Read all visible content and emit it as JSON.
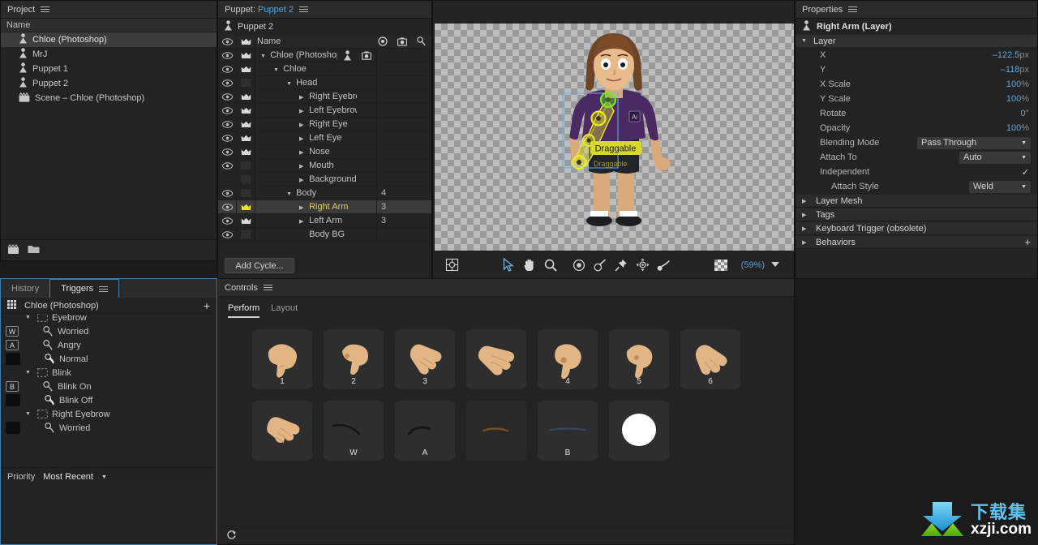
{
  "project": {
    "title": "Project",
    "menu_icon": "hamburger-icon",
    "column_header": "Name",
    "items": [
      {
        "label": "Chloe (Photoshop)",
        "icon": "puppet-icon",
        "selected": true
      },
      {
        "label": "MrJ",
        "icon": "puppet-icon",
        "selected": false
      },
      {
        "label": "Puppet 1",
        "icon": "puppet-icon",
        "selected": false
      },
      {
        "label": "Puppet 2",
        "icon": "puppet-icon",
        "selected": false
      },
      {
        "label": "Scene – Chloe (Photoshop)",
        "icon": "scene-icon",
        "selected": false
      }
    ],
    "footer_icons": [
      "new-scene-icon",
      "new-folder-icon"
    ]
  },
  "puppet": {
    "title_prefix": "Puppet:",
    "title_name": "Puppet 2",
    "menu_icon": "hamburger-icon",
    "root_label": "Puppet 2",
    "column_header": "Name",
    "header_icons": [
      "crosshair-icon",
      "camera-icon",
      "handle-icon"
    ],
    "rows": [
      {
        "label": "Chloe (Photoshop)",
        "depth": 0,
        "twirl": "down",
        "crown": true,
        "eye": true,
        "num": "",
        "icon1": "puppet-icon",
        "icon2": "camera-icon",
        "selected": false
      },
      {
        "label": "Chloe",
        "depth": 1,
        "twirl": "down",
        "crown": true,
        "eye": true,
        "num": "",
        "selected": false
      },
      {
        "label": "Head",
        "depth": 2,
        "twirl": "down",
        "crown": false,
        "eye": true,
        "num": "",
        "selected": false
      },
      {
        "label": "Right Eyebrow",
        "depth": 3,
        "twirl": "right",
        "crown": true,
        "eye": true,
        "num": "",
        "selected": false
      },
      {
        "label": "Left Eyebrow",
        "depth": 3,
        "twirl": "right",
        "crown": true,
        "eye": true,
        "num": "",
        "selected": false
      },
      {
        "label": "Right Eye",
        "depth": 3,
        "twirl": "right",
        "crown": true,
        "eye": true,
        "num": "",
        "selected": false
      },
      {
        "label": "Left Eye",
        "depth": 3,
        "twirl": "right",
        "crown": true,
        "eye": true,
        "num": "",
        "selected": false
      },
      {
        "label": "Nose",
        "depth": 3,
        "twirl": "right",
        "crown": true,
        "eye": true,
        "num": "",
        "selected": false
      },
      {
        "label": "Mouth",
        "depth": 3,
        "twirl": "right",
        "crown": false,
        "eye": true,
        "num": "",
        "selected": false
      },
      {
        "label": "Background",
        "depth": 3,
        "twirl": "right",
        "crown": false,
        "eye": false,
        "num": "",
        "selected": false
      },
      {
        "label": "Body",
        "depth": 2,
        "twirl": "down",
        "crown": false,
        "eye": true,
        "num": "4",
        "selected": false
      },
      {
        "label": "Right Arm",
        "depth": 3,
        "twirl": "right",
        "crown": true,
        "eye": true,
        "num": "3",
        "selected": true
      },
      {
        "label": "Left Arm",
        "depth": 3,
        "twirl": "right",
        "crown": true,
        "eye": true,
        "num": "3",
        "selected": false
      },
      {
        "label": "Body BG",
        "depth": 3,
        "twirl": "none",
        "crown": false,
        "eye": true,
        "num": "",
        "selected": false
      }
    ],
    "add_cycle_label": "Add Cycle..."
  },
  "canvas": {
    "zoom_label": "(59%)",
    "handle_labels": [
      "Draggable",
      "Draggable"
    ],
    "tools": [
      {
        "name": "origin-icon"
      },
      {
        "name": "arrow-select-icon",
        "active": true
      },
      {
        "name": "hand-pan-icon"
      },
      {
        "name": "magnifier-zoom-icon"
      },
      {
        "name": "handle-tool-icon"
      },
      {
        "name": "dangle-tool-icon"
      },
      {
        "name": "stick-pin-icon"
      },
      {
        "name": "dragger-tool-icon"
      },
      {
        "name": "pitch-tool-icon"
      },
      {
        "name": "transparency-grid-icon"
      },
      {
        "name": "zoom-dropdown-caret-icon"
      }
    ]
  },
  "properties": {
    "title": "Properties",
    "menu_icon": "hamburger-icon",
    "object_name": "Right Arm (Layer)",
    "object_icon": "puppet-icon",
    "layer_section": "Layer",
    "rows": [
      {
        "label": "X",
        "value": "–122.5",
        "unit": "px",
        "type": "number"
      },
      {
        "label": "Y",
        "value": "–118",
        "unit": "px",
        "type": "number"
      },
      {
        "label": "X Scale",
        "value": "100",
        "unit": "%",
        "type": "number"
      },
      {
        "label": "Y Scale",
        "value": "100",
        "unit": "%",
        "type": "number"
      },
      {
        "label": "Rotate",
        "value": "0",
        "unit": "°",
        "type": "number"
      },
      {
        "label": "Opacity",
        "value": "100",
        "unit": "%",
        "type": "number"
      }
    ],
    "blending_mode": {
      "label": "Blending Mode",
      "value": "Pass Through"
    },
    "attach_to": {
      "label": "Attach To",
      "value": "Auto"
    },
    "independent": {
      "label": "Independent",
      "checked": true,
      "check_glyph": "✓"
    },
    "attach_style": {
      "label": "Attach Style",
      "value": "Weld"
    },
    "collapsed_sections": [
      {
        "label": "Layer Mesh",
        "plus": false
      },
      {
        "label": "Tags",
        "plus": false
      },
      {
        "label": "Keyboard Trigger (obsolete)",
        "plus": false
      },
      {
        "label": "Behaviors",
        "plus": true,
        "plus_glyph": "+"
      }
    ]
  },
  "triggers": {
    "tabs": [
      {
        "label": "History",
        "active": false
      },
      {
        "label": "Triggers",
        "active": true
      }
    ],
    "menu_icon": "hamburger-icon",
    "puppet_name": "Chloe (Photoshop)",
    "grid_icon": "grid-icon",
    "add_glyph": "+",
    "rows": [
      {
        "label": "Eyebrow",
        "key": "",
        "depth": 1,
        "type": "group",
        "twirl": "down"
      },
      {
        "label": "Worried",
        "key": "W",
        "depth": 2,
        "type": "swap"
      },
      {
        "label": "Angry",
        "key": "A",
        "depth": 2,
        "type": "swap"
      },
      {
        "label": "Normal",
        "key": "",
        "depth": 2,
        "type": "swap-active"
      },
      {
        "label": "Blink",
        "key": "",
        "depth": 1,
        "type": "group",
        "twirl": "down"
      },
      {
        "label": "Blink On",
        "key": "B",
        "depth": 2,
        "type": "swap"
      },
      {
        "label": "Blink Off",
        "key": "",
        "depth": 2,
        "type": "swap-active"
      },
      {
        "label": "Right Eyebrow",
        "key": "",
        "depth": 1,
        "type": "group",
        "twirl": "down"
      },
      {
        "label": "Worried",
        "key": "",
        "depth": 2,
        "type": "swap"
      }
    ],
    "priority_label": "Priority",
    "priority_value": "Most Recent"
  },
  "controls": {
    "title": "Controls",
    "menu_icon": "hamburger-icon",
    "tabs": [
      {
        "label": "Perform",
        "active": true
      },
      {
        "label": "Layout",
        "active": false
      }
    ],
    "tiles": [
      {
        "label": "1",
        "art": "hand-point-down",
        "dim": false
      },
      {
        "label": "2",
        "art": "hand-point-down-2",
        "dim": false
      },
      {
        "label": "3",
        "art": "hand-open-left",
        "dim": false
      },
      {
        "label": "",
        "art": "hand-open-wide",
        "dim": false
      },
      {
        "label": "4",
        "art": "hand-point-down-3",
        "dim": false
      },
      {
        "label": "5",
        "art": "hand-point-down-4",
        "dim": false
      },
      {
        "label": "6",
        "art": "hand-open-right",
        "dim": false
      },
      {
        "label": "",
        "art": "hand-open-fingers",
        "dim": false
      },
      {
        "label": "W",
        "art": "eyebrow-worried",
        "dim": false
      },
      {
        "label": "A",
        "art": "eyebrow-angry",
        "dim": false
      },
      {
        "label": "",
        "art": "eyebrow-brown-faint",
        "dim": true
      },
      {
        "label": "B",
        "art": "eyelid-blue-line",
        "dim": false
      },
      {
        "label": "",
        "art": "white-circle",
        "dim": false
      }
    ],
    "footer_icon": "sync-refresh-icon"
  },
  "watermark": {
    "cn": "下载集",
    "en": "xzji.com",
    "icon": "download-arrow-logo"
  },
  "colors": {
    "panel_bg": "#232323",
    "panel_head": "#2b2b2b",
    "accent_blue": "#5aa4d6",
    "value_blue": "#6aa6d2",
    "selected_row": "#3b3b3b",
    "selected_text": "#d6cf66",
    "handle_yellow": "#e8e82c",
    "handle_green": "#7ee62a",
    "skin": "#e2b584",
    "shirt_purple": "#4b2a63",
    "hair_brown": "#7b4a2a",
    "tab_border": "#3f7fae"
  }
}
